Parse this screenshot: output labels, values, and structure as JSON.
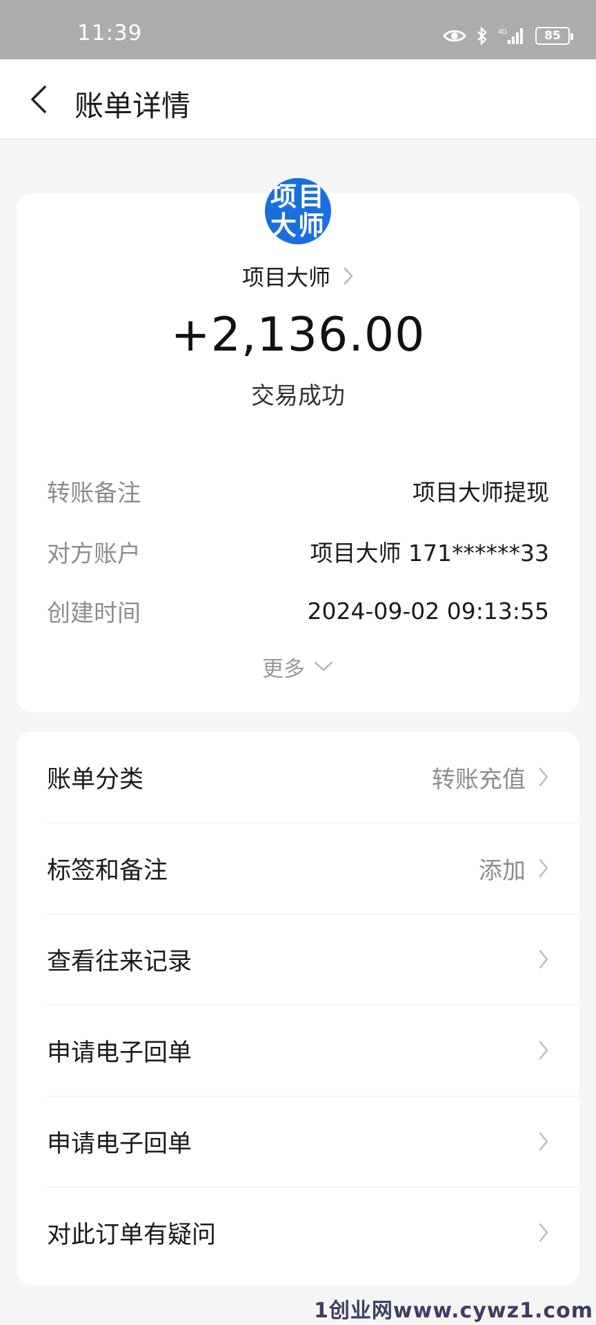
{
  "status_bar": {
    "time": "11:39",
    "network": "4G",
    "battery": "85",
    "icons": [
      "eye-icon",
      "bluetooth-icon",
      "signal-icon",
      "battery-icon"
    ]
  },
  "header": {
    "title": "账单详情",
    "back_icon": "chevron-left-icon"
  },
  "summary": {
    "avatar_text": [
      "项目",
      "大师"
    ],
    "avatar_color": "#1a6fe0",
    "payee": "项目大师",
    "amount": "+2,136.00",
    "status": "交易成功"
  },
  "details": [
    {
      "label": "转账备注",
      "value": "项目大师提现"
    },
    {
      "label": "对方账户",
      "value": "项目大师 171******33"
    },
    {
      "label": "创建时间",
      "value": "2024-09-02 09:13:55"
    }
  ],
  "more_label": "更多",
  "menu": [
    {
      "label": "账单分类",
      "value": "转账充值"
    },
    {
      "label": "标签和备注",
      "value": "添加"
    },
    {
      "label": "查看往来记录",
      "value": ""
    },
    {
      "label": "申请电子回单",
      "value": ""
    },
    {
      "label": "申请电子回单",
      "value": ""
    },
    {
      "label": "对此订单有疑问",
      "value": ""
    }
  ],
  "watermark": "1创业网www.cywz1.com"
}
